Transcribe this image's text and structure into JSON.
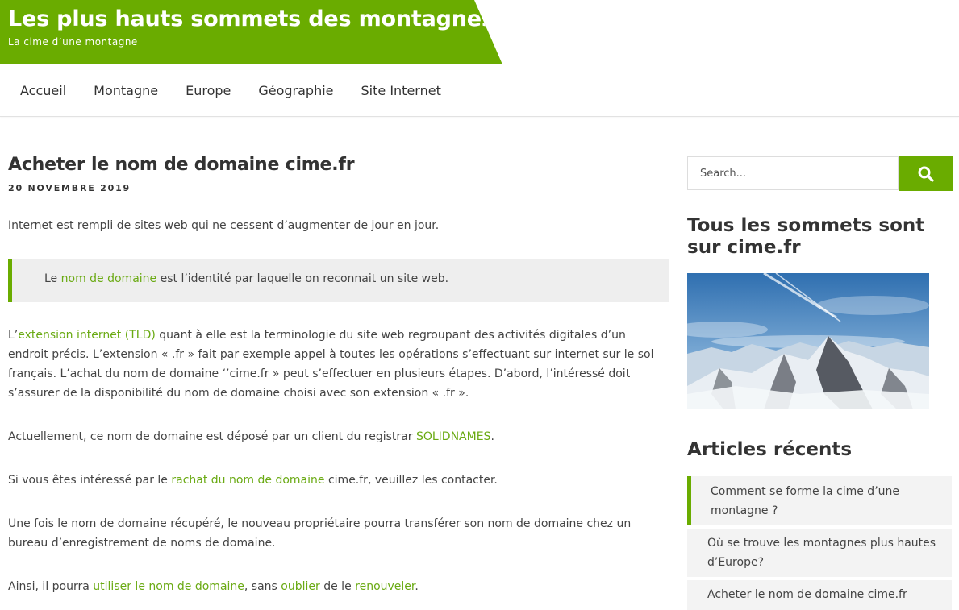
{
  "header": {
    "title": "Les plus hauts sommets des montagnes",
    "tagline": "La cime d’une montagne",
    "brand_color": "#6aac00"
  },
  "nav": [
    "Accueil",
    "Montagne",
    "Europe",
    "Géographie",
    "Site Internet"
  ],
  "post": {
    "title": "Acheter le nom de domaine cime.fr",
    "date": "20 NOVEMBRE 2019",
    "p1": "Internet est rempli de sites web qui ne cessent d’augmenter de jour en jour.",
    "quote": {
      "before": "Le ",
      "link": "nom de domaine",
      "after": " est l’identité par laquelle on reconnait un site web."
    },
    "p2": {
      "before": "L’",
      "link": "extension internet (TLD)",
      "after": " quant à elle est la terminologie du site web regroupant des activités digitales d’un endroit précis. L’extension « .fr » fait par exemple appel à toutes les opérations s’effectuant sur internet sur le sol français. L’achat du nom de domaine ‘’cime.fr » peut s’effectuer en plusieurs étapes. D’abord, l’intéressé doit s’assurer de la disponibilité du nom de domaine choisi avec son extension « .fr »."
    },
    "p3": {
      "before": "Actuellement, ce nom de domaine est déposé par un client du registrar ",
      "link": "SOLIDNAMES",
      "after": "."
    },
    "p4": {
      "before": "Si vous êtes intéressé par le ",
      "link": "rachat du nom de domaine",
      "after": " cime.fr, veuillez les contacter."
    },
    "p5": "Une fois le nom de domaine récupéré, le nouveau propriétaire pourra transférer son nom de domaine chez un bureau d’enregistrement de noms de domaine.",
    "p6": {
      "before": "Ainsi, il pourra ",
      "link1": "utiliser le nom de domaine",
      "mid1": ", sans ",
      "link2": "oublier",
      "mid2": " de le ",
      "link3": "renouveler",
      "after": "."
    }
  },
  "sidebar": {
    "search_placeholder": "Search...",
    "search_icon": "search-icon",
    "widget1_title": "Tous les sommets sont sur cime.fr",
    "widget2_title": "Articles récents",
    "recent": [
      "Comment se forme la cime d’une montagne ?",
      "Où se trouve les montagnes plus hautes d’Europe?",
      "Acheter le nom de domaine cime.fr"
    ]
  }
}
